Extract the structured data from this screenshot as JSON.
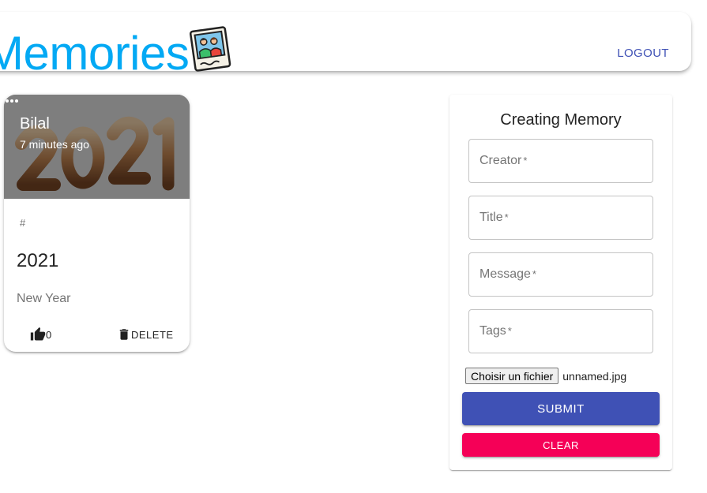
{
  "app": {
    "title": "Memories",
    "logo_icon": "memories-photo-icon",
    "logout_label": "LOGOUT",
    "colors": {
      "brand": "#03a9f4",
      "primary": "#3f51b5",
      "secondary": "#f50057"
    }
  },
  "posts": [
    {
      "creator": "Bilal",
      "time": "7 minutes ago",
      "tags": "#",
      "title": "2021",
      "message": "New Year",
      "like_count": "0",
      "delete_label": "DELETE",
      "media_icon": "golden-2021-image"
    }
  ],
  "form": {
    "heading": "Creating Memory",
    "fields": {
      "creator": {
        "label": "Creator",
        "required_mark": "*",
        "value": ""
      },
      "title": {
        "label": "Title",
        "required_mark": "*",
        "value": ""
      },
      "message": {
        "label": "Message",
        "required_mark": "*",
        "value": ""
      },
      "tags": {
        "label": "Tags",
        "required_mark": "*",
        "value": ""
      }
    },
    "file": {
      "button_label": "Choisir un fichier",
      "file_name": "unnamed.jpg"
    },
    "submit_label": "SUBMIT",
    "clear_label": "CLEAR"
  }
}
